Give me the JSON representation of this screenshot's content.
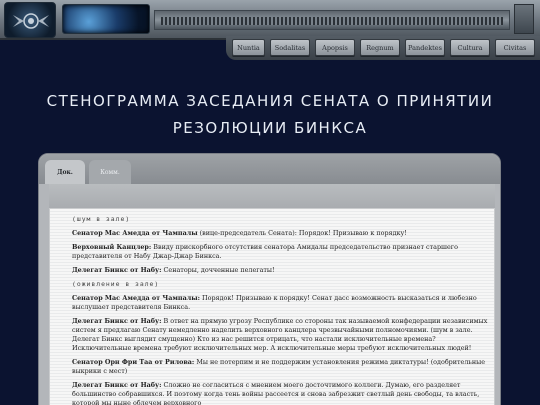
{
  "nav": {
    "items": [
      {
        "label": "Nuntia"
      },
      {
        "label": "Sodalitas"
      },
      {
        "label": "Apopsis"
      },
      {
        "label": "Regnum"
      },
      {
        "label": "Pandektes"
      },
      {
        "label": "Cultura"
      },
      {
        "label": "Civitas"
      }
    ]
  },
  "page": {
    "title_line1": "Стенограмма заседания Сената о принятии",
    "title_line2": "резолюции Бинкса"
  },
  "tabs": {
    "active": "Док.",
    "inactive": "Комм."
  },
  "transcript": [
    {
      "type": "note",
      "text": "(шум в зале)"
    },
    {
      "type": "speech",
      "speaker": "Сенатор Мас Амедда от Чампалы",
      "text": " (вице-председатель Сената): Порядок! Призываю к порядку!"
    },
    {
      "type": "speech",
      "speaker": "Верховный Канцлер:",
      "text": " Ввиду прискорбного отсутствия сенатора Амидалы председательство признает старшего представителя от Набу Джар-Джар Бинкса."
    },
    {
      "type": "speech",
      "speaker": "Делегат Бинкс от Набу:",
      "text": " Сенаторы, дочченные пелегаты!"
    },
    {
      "type": "note",
      "text": "(оживление в зале)"
    },
    {
      "type": "speech",
      "speaker": "Сенатор Мас Амедда от Чампалы:",
      "text": " Порядок! Призываю к порядку! Сенат дасс возможность высказаться и любезно выслушает представителя Бинкса."
    },
    {
      "type": "speech",
      "speaker": "Делегат Бинкс от Набу:",
      "text": " В ответ на прямую угрозу Республике со стороны так называемой конфедерации независимых систем я предлагаю Сенату немедленно наделить верховного канцлера чрезвычайными полномочиями. (шум в зале. Делегат Бинкс выглядит смущенно) Кто из нас решится отрицать, что настали исключительные времена? Исключительные времена требуют исключительных мер. А исключительные меры требуют исключительных людей!"
    },
    {
      "type": "speech",
      "speaker": "Сенатор Орн Фри Таа от Рилова:",
      "text": " Мы не потерпим и не поддержим установления режима диктатуры! (одобрительные выкрики с мест)"
    },
    {
      "type": "speech",
      "speaker": "Делегат Бинкс от Набу:",
      "text": " Сложно не согласиться с мнением моего досточтимого коллеги. Думаю, его разделяет большинство собравшихся. И поэтому когда тень войны рассеется и снова забрезжит светлый день свободы, та власть, которой мы ныне облечем верховного"
    }
  ]
}
